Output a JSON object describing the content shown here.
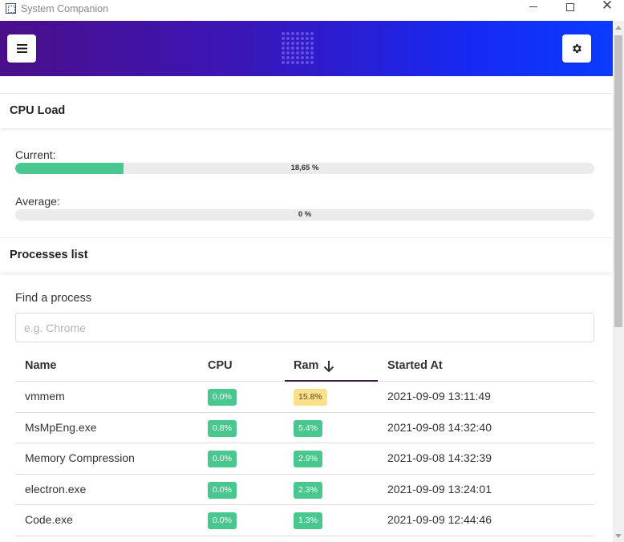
{
  "window": {
    "title": "System Companion"
  },
  "header": {
    "menu_icon": "hamburger-menu-icon",
    "settings_icon": "gear-icon",
    "gradient_start": "#4b0f8a",
    "gradient_end": "#0a3cff"
  },
  "cpu": {
    "heading": "CPU Load",
    "current_label": "Current:",
    "current_value": "18,65 %",
    "current_fraction": 0.1865,
    "average_label": "Average:",
    "average_value": "0 %",
    "average_fraction": 0
  },
  "processes": {
    "heading": "Processes list",
    "search_label": "Find a process",
    "search_placeholder": "e.g. Chrome",
    "search_value": "",
    "columns": {
      "name": "Name",
      "cpu": "CPU",
      "ram": "Ram",
      "started": "Started At"
    },
    "sort": {
      "column": "ram",
      "direction": "descending",
      "icon": "arrow-down-icon"
    },
    "rows": [
      {
        "name": "vmmem",
        "cpu": "0.0%",
        "ram": "15.8%",
        "started": "2021-09-09 13:11:49",
        "ram_status": "warning"
      },
      {
        "name": "MsMpEng.exe",
        "cpu": "0.8%",
        "ram": "5.4%",
        "started": "2021-09-08 14:32:40",
        "ram_status": "ok"
      },
      {
        "name": "Memory Compression",
        "cpu": "0.0%",
        "ram": "2.9%",
        "started": "2021-09-08 14:32:39",
        "ram_status": "ok"
      },
      {
        "name": "electron.exe",
        "cpu": "0.0%",
        "ram": "2.3%",
        "started": "2021-09-09 13:24:01",
        "ram_status": "ok"
      },
      {
        "name": "Code.exe",
        "cpu": "0.0%",
        "ram": "1.3%",
        "started": "2021-09-09 12:44:46",
        "ram_status": "ok"
      }
    ]
  },
  "colors": {
    "success": "#48c78e",
    "warning": "#ffe08a",
    "progress_track": "#ebebeb"
  }
}
